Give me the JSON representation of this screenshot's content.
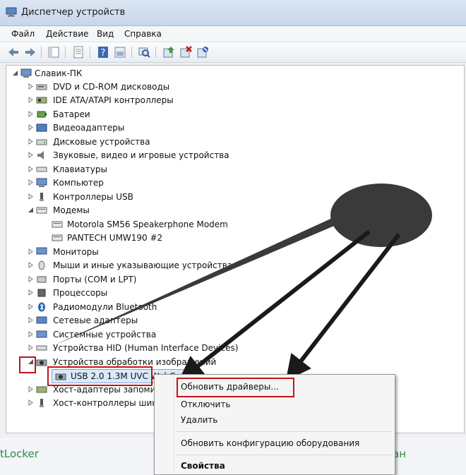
{
  "window": {
    "title": "Диспетчер устройств"
  },
  "menu": {
    "file": "Файл",
    "action": "Действие",
    "view": "Вид",
    "help": "Справка"
  },
  "tree": {
    "root": "Славик-ПК",
    "categories": [
      "DVD и CD-ROM дисководы",
      "IDE ATA/ATAPI контроллеры",
      "Батареи",
      "Видеоадаптеры",
      "Дисковые устройства",
      "Звуковые, видео и игровые устройства",
      "Клавиатуры",
      "Компьютер",
      "Контроллеры USB",
      "Модемы",
      "Motorola SM56 Speakerphone Modem",
      "PANTECH UMW190 #2",
      "Мониторы",
      "Мыши и иные указывающие устройства",
      "Порты (COM и LPT)",
      "Процессоры",
      "Радиомодули Bluetooth",
      "Сетевые адаптеры",
      "Системные устройства",
      "Устройства HID (Human Interface Devices)",
      "Устройства обработки изображений",
      "USB 2.0 1.3M UVC WebCam",
      "Хост-адаптеры запоминающих устройств",
      "Хост-контроллеры шины IEEE 1394"
    ]
  },
  "context_menu": {
    "update": "Обновить драйверы...",
    "disable": "Отключить",
    "delete": "Удалить",
    "scan": "Обновить конфигурацию оборудования",
    "properties": "Свойства"
  },
  "background": {
    "left_text": "tLocker",
    "right_text": "ан"
  },
  "colors": {
    "highlight": "#c0151a",
    "selection": "#dbe9f9",
    "arrow": "#1a1a1a",
    "bubble": "#3a3a3a"
  }
}
